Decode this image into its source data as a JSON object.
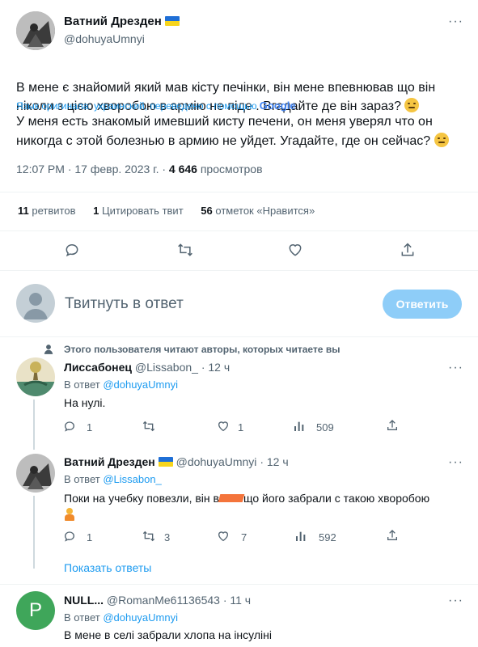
{
  "main_tweet": {
    "author_name": "Ватний Дрезден",
    "author_handle": "@dohuyaUmnyi",
    "text_original": "В мене є знайомий який мав кісту печінки, він мене впевнював що він ніколи з цією хворобою в армію не піде . Вгадайте де він зараз?",
    "translation_note": "Язык оригинала: украинский, переведено с помощью",
    "translation_brand": "Google",
    "text_translated": "У меня есть знакомый имевший кисту печени, он меня уверял что он никогда с этой болезнью в армию не уйдет. Угадайте, где он сейчас?",
    "time": "12:07 PM · 17 февр. 2023 г. · ",
    "views_count": "4 646",
    "views_label": " просмотров",
    "retweets_count": "11",
    "retweets_label": "ретвитов",
    "quotes_count": "1",
    "quotes_label": "Цитировать твит",
    "likes_count": "56",
    "likes_label": "отметок «Нравится»"
  },
  "reply_box": {
    "placeholder": "Твитнуть в ответ",
    "button": "Ответить"
  },
  "context_note": "Этого пользователя читают авторы, которых читаете вы",
  "replies": [
    {
      "name": "Лиссабонец",
      "handle": "@Lissabon_",
      "time": "· 12 ч",
      "reply_to_label": "В ответ ",
      "reply_to": "@dohuyaUmnyi",
      "text": "На нулі.",
      "comments": "1",
      "retweets": "",
      "likes": "1",
      "views": "509"
    },
    {
      "name": "Ватний Дрезден",
      "handle": "@dohuyaUmnyi",
      "time": "· 12 ч",
      "reply_to_label": "В ответ ",
      "reply_to": "@Lissabon_",
      "text_before": "Поки на учебку повезли, він в",
      "text_after": "що його забрали с такою хворобою",
      "comments": "1",
      "retweets": "3",
      "likes": "7",
      "views": "592"
    },
    {
      "name": "NULL...",
      "handle": "@RomanMe61136543",
      "time": "· 11 ч",
      "avatar_letter": "P",
      "reply_to_label": "В ответ ",
      "reply_to": "@dohuyaUmnyi",
      "text": "В мене в селі забрали хлопа на інсуліні"
    }
  ],
  "show_replies": "Показать ответы",
  "colors": {
    "accent": "#1d9bf0",
    "muted": "#536471",
    "divider": "#eff3f4",
    "avatar_p": "#3fa65a",
    "flag_blue": "#1f6fd6",
    "flag_yellow": "#f7d51d"
  },
  "icons": [
    "reply-icon",
    "retweet-icon",
    "like-icon",
    "share-icon",
    "views-icon",
    "more-icon",
    "person-icon"
  ]
}
